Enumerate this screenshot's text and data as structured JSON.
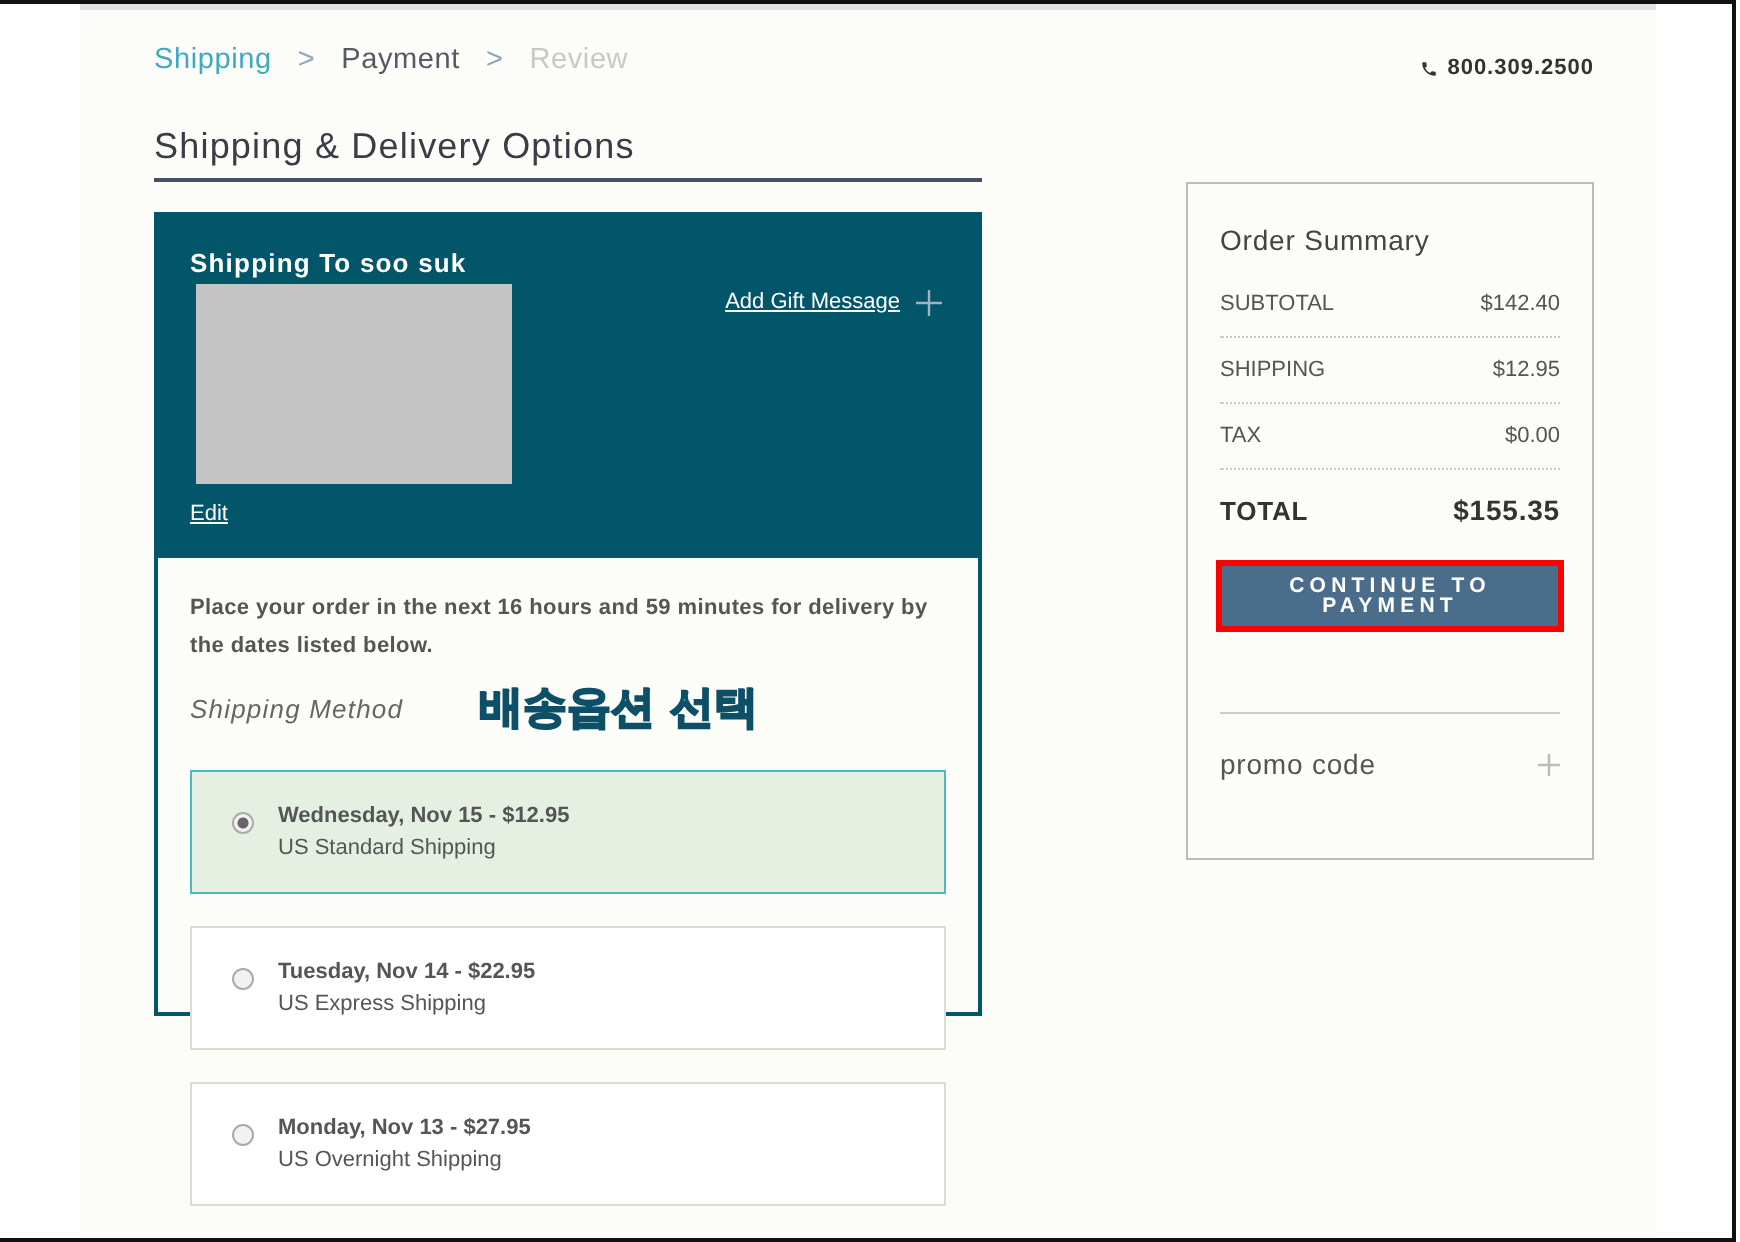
{
  "breadcrumb": [
    {
      "kind": "done",
      "label": "Shipping"
    },
    {
      "kind": "separator",
      "label": ">"
    },
    {
      "kind": "current",
      "label": "Payment"
    },
    {
      "kind": "separator",
      "label": ">"
    },
    {
      "kind": "pending",
      "label": "Review"
    }
  ],
  "phone": "800.309.2500",
  "heading": "Shipping & Delivery Options",
  "address_panel": {
    "title": "Shipping To soo suk",
    "address": {
      "kind": "redacted"
    },
    "edit_link": "Edit",
    "gift_link": "Add Gift Message"
  },
  "notice": "Place your order in the next 16 hours and 59 minutes for delivery by the dates listed below.",
  "method_label": "Shipping Method",
  "annotation": "배송옵션 선택",
  "shipping_options": [
    {
      "date": "Wednesday, Nov 15 - $12.95",
      "service": "US Standard Shipping",
      "selected": true
    },
    {
      "date": "Tuesday, Nov 14 - $22.95",
      "service": "US Express Shipping",
      "selected": false
    },
    {
      "date": "Monday, Nov 13 - $27.95",
      "service": "US Overnight Shipping",
      "selected": false
    }
  ],
  "summary": {
    "title": "Order Summary",
    "lines": [
      {
        "label": "SUBTOTAL",
        "value": "$142.40"
      },
      {
        "label": "SHIPPING",
        "value": "$12.95"
      },
      {
        "label": "TAX",
        "value": "$0.00"
      }
    ],
    "total": {
      "label": "TOTAL",
      "value": "$155.35"
    },
    "continue_button": {
      "label": "CONTINUE TO PAYMENT",
      "highlighted": true
    },
    "promo_label": "promo code"
  }
}
